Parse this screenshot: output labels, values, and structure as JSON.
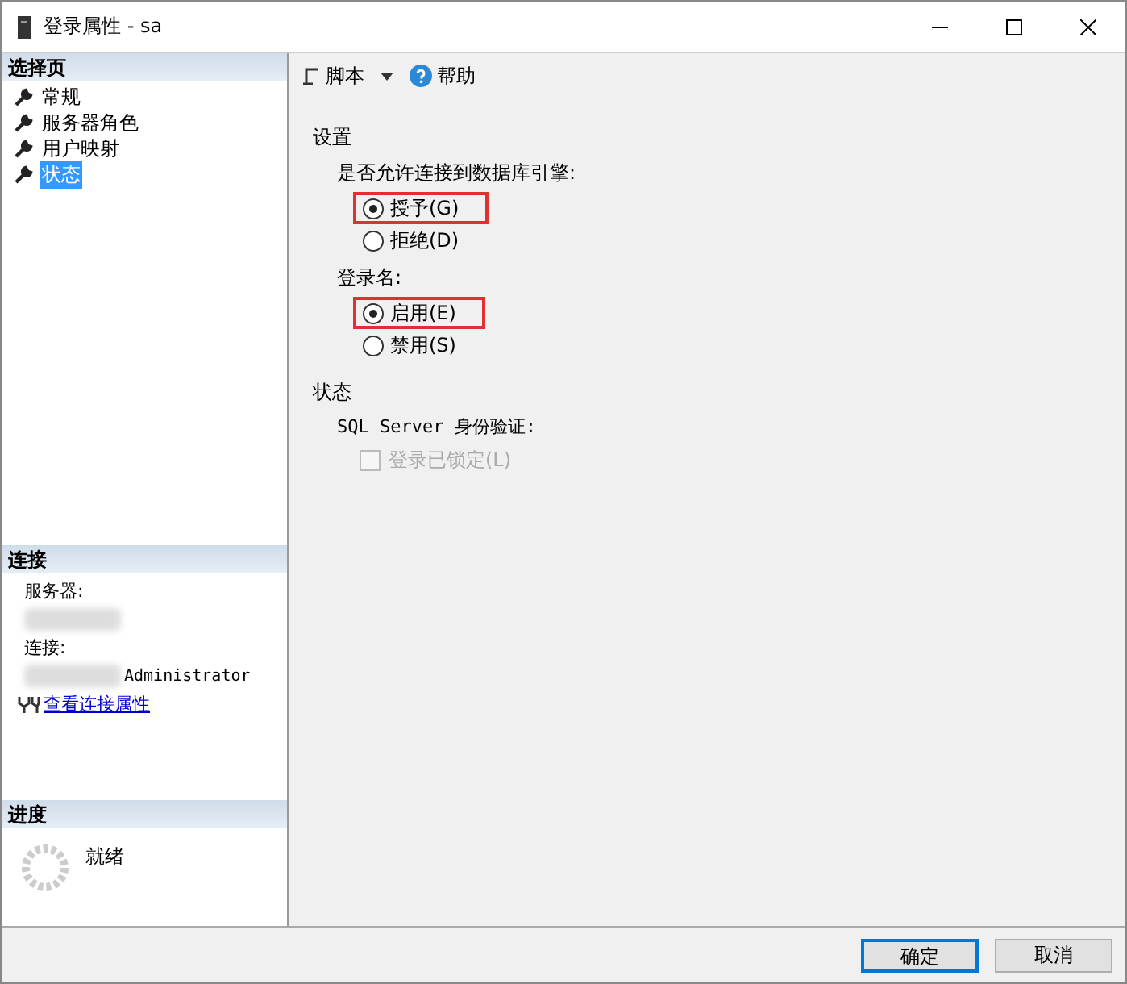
{
  "window": {
    "title": "登录属性 - sa"
  },
  "sidebar": {
    "header": "选择页",
    "items": [
      {
        "label": "常规",
        "selected": false
      },
      {
        "label": "服务器角色",
        "selected": false
      },
      {
        "label": "用户映射",
        "selected": false
      },
      {
        "label": "状态",
        "selected": true
      }
    ]
  },
  "connection": {
    "header": "连接",
    "server_label": "服务器:",
    "connection_label": "连接:",
    "connection_value": "Administrator",
    "link": "查看连接属性"
  },
  "progress": {
    "header": "进度",
    "status": "就绪"
  },
  "toolbar": {
    "script": "脚本",
    "help": "帮助"
  },
  "settings": {
    "title": "设置",
    "groups": [
      {
        "label": "是否允许连接到数据库引擎:",
        "options": [
          {
            "label": "授予(G)",
            "selected": true,
            "highlighted": true
          },
          {
            "label": "拒绝(D)",
            "selected": false,
            "highlighted": false
          }
        ]
      },
      {
        "label": "登录名:",
        "options": [
          {
            "label": "启用(E)",
            "selected": true,
            "highlighted": true
          },
          {
            "label": "禁用(S)",
            "selected": false,
            "highlighted": false
          }
        ]
      }
    ]
  },
  "status": {
    "title": "状态",
    "auth_label": "SQL Server 身份验证:",
    "locked": {
      "label": "登录已锁定(L)",
      "checked": false,
      "disabled": true
    }
  },
  "buttons": [
    "确定",
    "取消"
  ]
}
